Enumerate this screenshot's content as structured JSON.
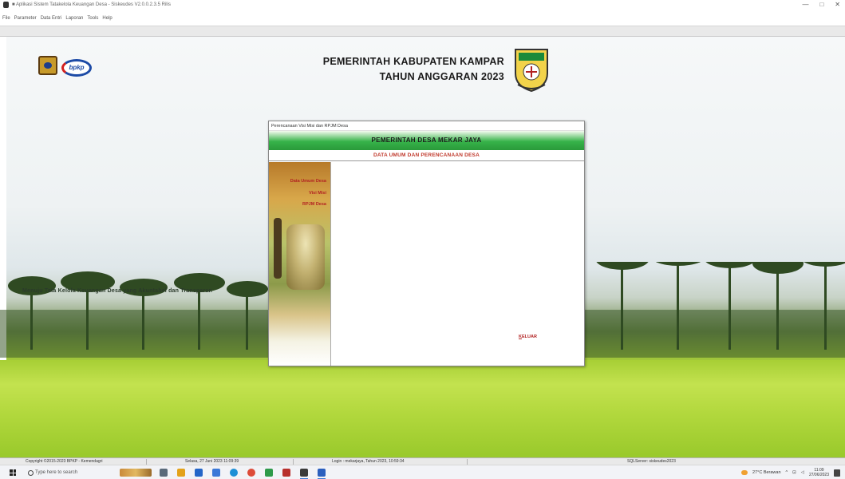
{
  "window": {
    "title": "■ Aplikasi Sistem Tatakelola Keuangan Desa - Siskeudes V2.0.0.2.3.5 Rilis",
    "controls": [
      "—",
      "□",
      "✕"
    ]
  },
  "menu": {
    "items": [
      "File",
      "Parameter",
      "Data Entri",
      "Laporan",
      "Tools",
      "Help"
    ]
  },
  "header": {
    "line1": "PEMERINTAH KABUPATEN KAMPAR",
    "line2": "TAHUN ANGGARAN 2023",
    "logo_text": "bpkp"
  },
  "tagline": "Menuju Tata Kelola Keuangan Desa yang Akuntabel dan Transparan",
  "dialog": {
    "title": "Perencanaan Visi Misi dan RPJM Desa",
    "header": "PEMERINTAH DESA MEKAR JAYA",
    "subheader": "DATA UMUM DAN PERENCANAAN DESA",
    "nav": [
      "Data Umum Desa",
      "Visi Misi",
      "RPJM Desa"
    ],
    "keluar_underline": "K",
    "keluar_rest": "ELUAR"
  },
  "statusbar": {
    "copyright": "Copyright ©2015-2023 BPKP - Kemendagri",
    "datetime": "Selasa, 27 Juni 2023  11:09:39",
    "login": "Login : mekarjaya,  Tahun 2023, 10:59:34",
    "server": "SQLServer: siskeudes2023"
  },
  "taskbar": {
    "search_placeholder": "Type here to search",
    "weather": "27°C  Berawan",
    "time": "11:09",
    "date": "27/06/2023"
  },
  "colors": {
    "accent_green": "#37b34a",
    "link_red": "#b22222",
    "subheader_red": "#c0392b"
  }
}
